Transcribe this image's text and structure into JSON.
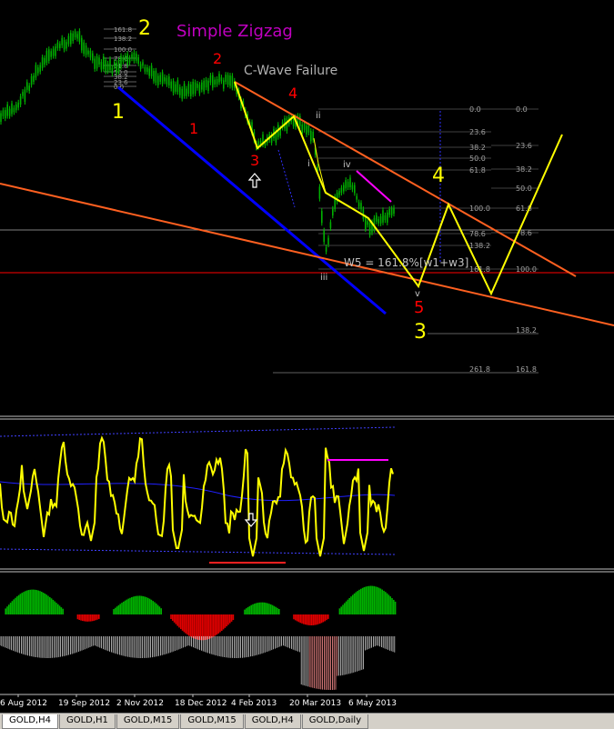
{
  "title": "Simple Zigzag",
  "annotations": {
    "c_wave_failure": "C-Wave Failure",
    "w5_formula": "W5 = 161.8%[w1+w3]"
  },
  "wave_labels": [
    {
      "text": "1",
      "color": "#ffff00"
    },
    {
      "text": "2",
      "color": "#ffff00"
    },
    {
      "text": "1",
      "color": "#ff0000"
    },
    {
      "text": "2",
      "color": "#ff0000"
    },
    {
      "text": "3",
      "color": "#ff0000"
    },
    {
      "text": "4",
      "color": "#ff0000"
    },
    {
      "text": "5",
      "color": "#ff0000"
    },
    {
      "text": "3",
      "color": "#ffff00"
    },
    {
      "text": "4",
      "color": "#ffff00"
    }
  ],
  "minor_labels": [
    "ii",
    "i",
    "iv",
    "iii",
    "v"
  ],
  "fib_top": [
    "161.8",
    "138.2",
    "100.0",
    "78.6",
    "61.8",
    "50.0",
    "38.2",
    "23.6",
    "0.0"
  ],
  "fib_mid": [
    "0.0",
    "23.6",
    "38.2",
    "50.0",
    "61.8",
    "78.6",
    "100.0",
    "138.2",
    "161.8"
  ],
  "fib_right": [
    "0.0",
    "23.6",
    "38.2",
    "50.0",
    "61.8",
    "78.6",
    "100.0"
  ],
  "fib_proj": [
    "138.2",
    "261.8",
    "161.8"
  ],
  "x_axis_labels": [
    "6 Aug 2012",
    "19 Sep 2012",
    "2 Nov 2012",
    "18 Dec 2012",
    "4 Feb 2013",
    "20 Mar 2013",
    "6 May 2013"
  ],
  "tabs": [
    "GOLD,H4",
    "GOLD,H1",
    "GOLD,M15",
    "GOLD,M15",
    "GOLD,H4",
    "GOLD,Daily"
  ],
  "colors": {
    "background": "#000000",
    "candle": "#00c000",
    "zigzag": "#ffff00",
    "downtrend": "#0000ff",
    "channel": "#ff6020",
    "horizontal": "#ff0000",
    "title": "#c000c0",
    "oscillator": "#ffff00",
    "histo_up": "#00c000",
    "histo_down": "#ff0000",
    "histo_neg": "#ffffff",
    "histo_neg_pink": "#ff8080"
  }
}
